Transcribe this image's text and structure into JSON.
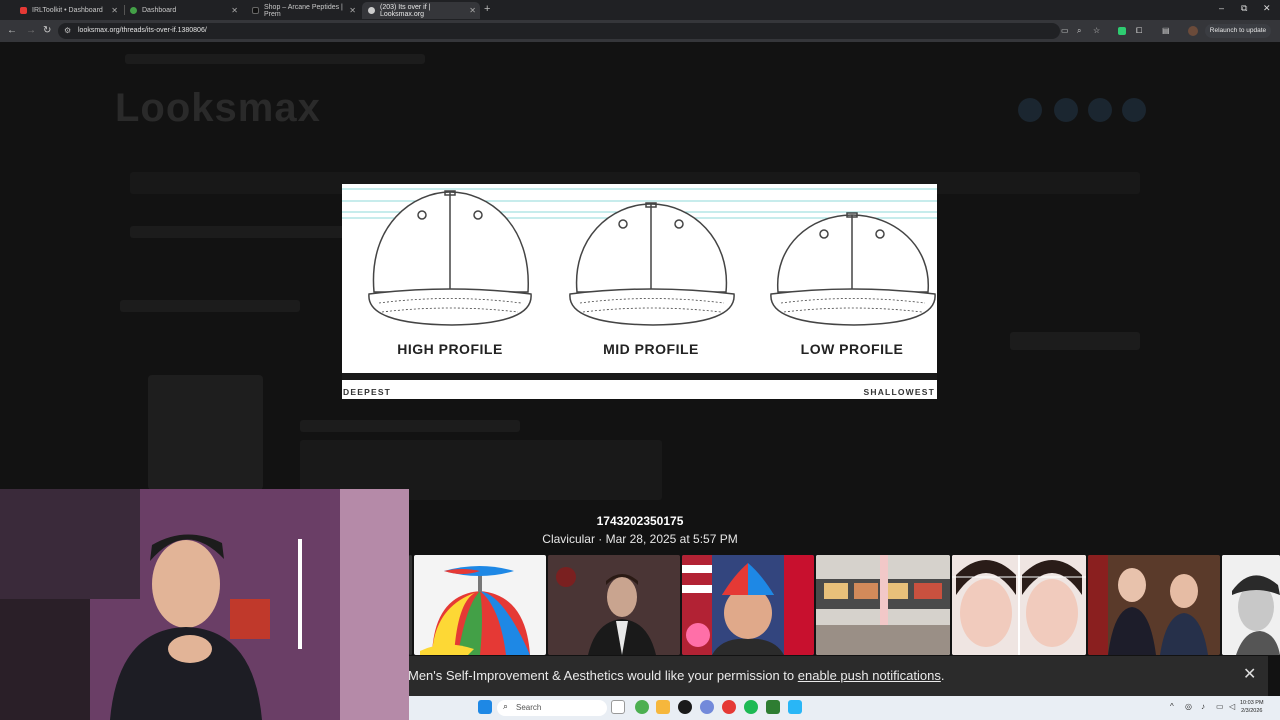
{
  "browser": {
    "tabs": [
      {
        "label": "IRLToolkit • Dashboard",
        "color": "#e53935"
      },
      {
        "label": "Dashboard",
        "color": "#43a047"
      },
      {
        "label": "Shop – Arcane Peptides | Prem",
        "color": "#111111"
      },
      {
        "label": "(203) Its over if | Looksmax.org",
        "color": "#cccccc"
      }
    ],
    "new_tab": "+",
    "url": "looksmax.org/threads/its-over-if.1380806/",
    "relaunch_label": "Relaunch to update"
  },
  "lightbox": {
    "hats": [
      "HIGH PROFILE",
      "MID PROFILE",
      "LOW PROFILE"
    ],
    "depth_left": "DEEPEST",
    "depth_right": "SHALLOWEST",
    "caption_title": "1743202350175",
    "caption_sub": "Clavicular · Mar 28, 2025 at 5:57 PM"
  },
  "notification": {
    "text": "Men's Self-Improvement & Aesthetics would like your permission to",
    "link": "enable push notifications",
    "suffix": ".",
    "close": "✕"
  },
  "taskbar": {
    "search": "Search",
    "time": "10:03 PM",
    "date": "2/3/2026"
  },
  "colors": {
    "accent_green": "#2ecc71",
    "page_bg": "#121212",
    "lightbox_bg": "#ffffff"
  }
}
